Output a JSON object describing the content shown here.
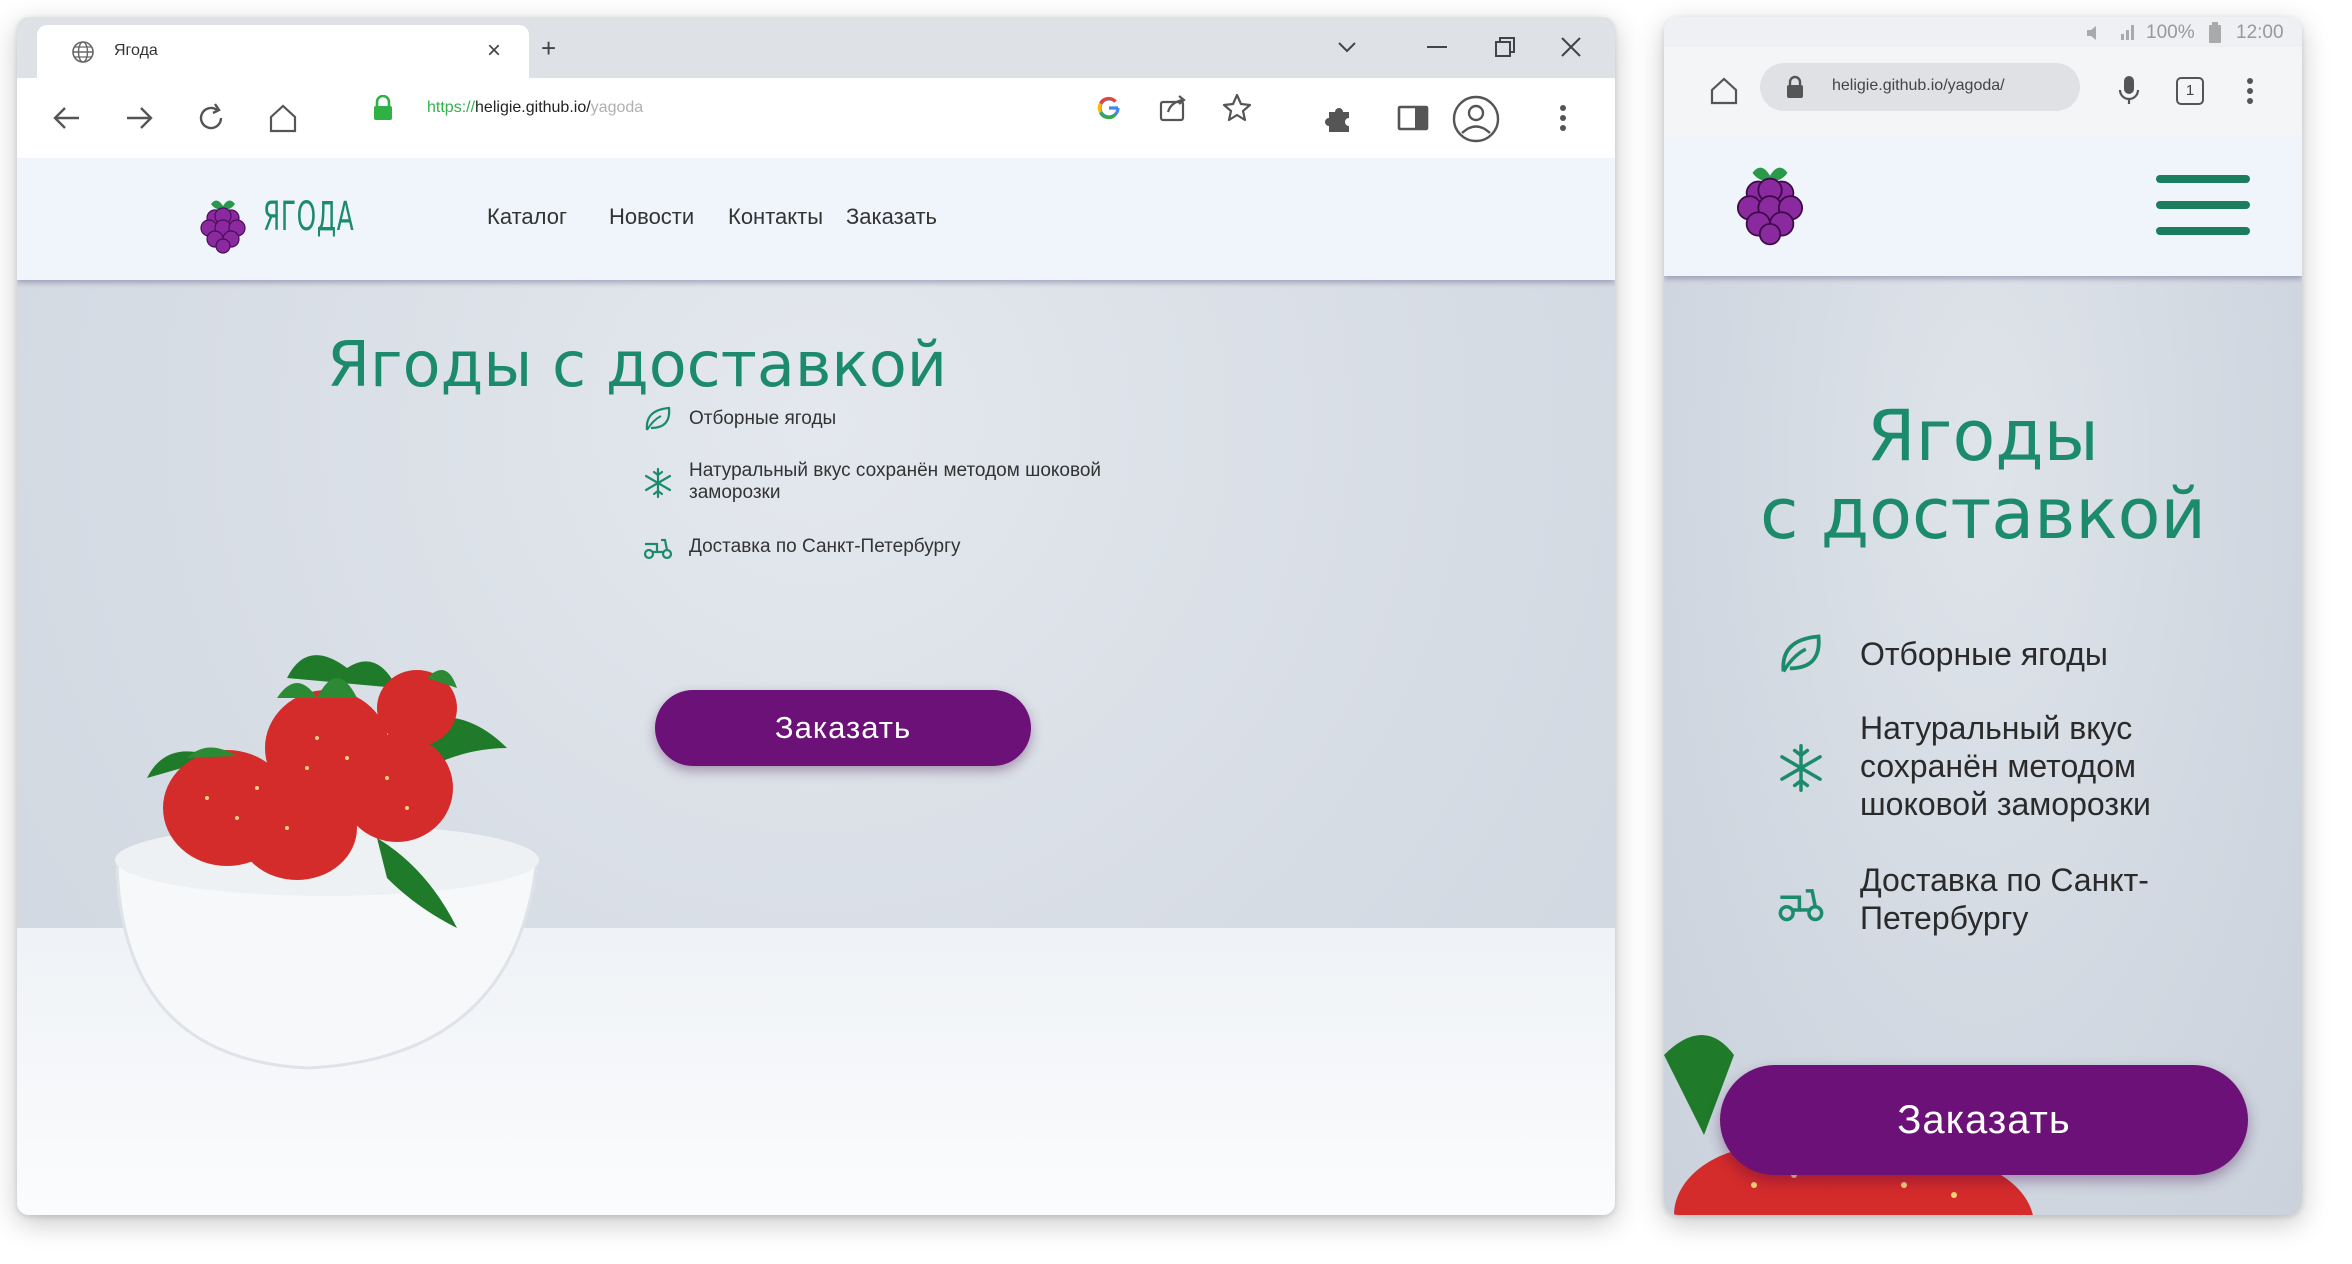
{
  "desktop": {
    "tab_title": "Ягода",
    "new_tab_symbol": "+",
    "tab_close_symbol": "×",
    "url": {
      "scheme": "https://",
      "host": "heligie.github.io/",
      "path": "yagoda"
    },
    "site": {
      "logo_text": "ЯГОДА",
      "nav": [
        "Каталог",
        "Новости",
        "Контакты",
        "Заказать"
      ],
      "hero_title": "Ягоды с доставкой",
      "features": [
        {
          "icon": "leaf-icon",
          "text": "Отборные ягоды"
        },
        {
          "icon": "snowflake-icon",
          "text": "Натуральный вкус сохранён методом шоковой заморозки"
        },
        {
          "icon": "scooter-icon",
          "text": "Доставка по Санкт-Петербургу"
        }
      ],
      "cta": "Заказать"
    }
  },
  "mobile": {
    "status": {
      "battery": "100%",
      "time": "12:00"
    },
    "url": "heligie.github.io/yagoda/",
    "tabs_count": "1",
    "site": {
      "hero_title_line1": "Ягоды",
      "hero_title_line2": "с доставкой",
      "features": [
        {
          "icon": "leaf-icon",
          "text": "Отборные ягоды"
        },
        {
          "icon": "snowflake-icon",
          "text": "Натуральный вкус сохранён методом шоковой заморозки"
        },
        {
          "icon": "scooter-icon",
          "text": "Доставка по Санкт-Петербургу"
        }
      ],
      "cta": "Заказать"
    }
  },
  "colors": {
    "brand_green": "#1c8b6c",
    "cta_purple": "#6b1178",
    "header_bg": "#f0f4fb",
    "url_green": "#33b24a"
  }
}
